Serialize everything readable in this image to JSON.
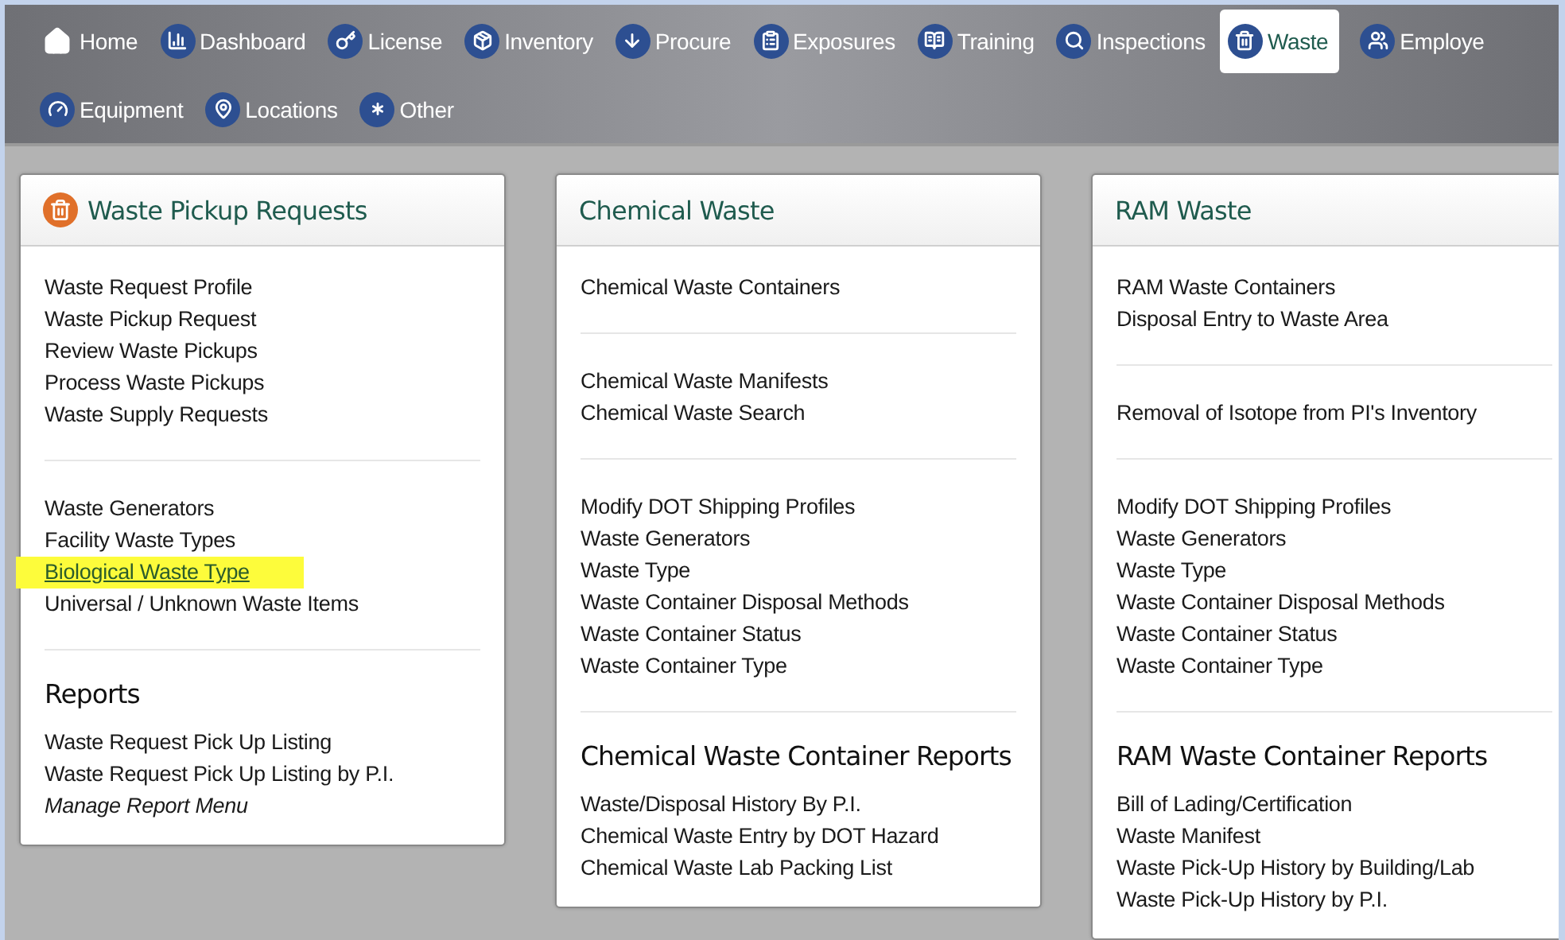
{
  "nav": {
    "rows": [
      [
        {
          "label": "Home",
          "selected": false
        },
        {
          "label": "Dashboard",
          "selected": false
        },
        {
          "label": "License",
          "selected": false
        },
        {
          "label": "Inventory",
          "selected": false
        },
        {
          "label": "Procure",
          "selected": false
        },
        {
          "label": "Exposures",
          "selected": false
        },
        {
          "label": "Training",
          "selected": false
        },
        {
          "label": "Inspections",
          "selected": false
        },
        {
          "label": "Waste",
          "selected": true
        },
        {
          "label": "Employe",
          "selected": false
        }
      ],
      [
        {
          "label": "Equipment",
          "selected": false
        },
        {
          "label": "Locations",
          "selected": false
        },
        {
          "label": "Other",
          "selected": false
        }
      ]
    ]
  },
  "panels": [
    {
      "title": "Waste Pickup Requests",
      "sections": [
        {
          "links": [
            {
              "text": "Waste Request Profile",
              "kind": "link"
            },
            {
              "text": "Waste Pickup Request",
              "kind": "link"
            },
            {
              "text": "Review Waste Pickups",
              "kind": "link"
            },
            {
              "text": "Process Waste Pickups",
              "kind": "link"
            },
            {
              "text": "Waste Supply Requests",
              "kind": "link"
            }
          ]
        },
        {
          "links": [
            {
              "text": "Waste Generators",
              "kind": "link"
            },
            {
              "text": "Facility Waste Types",
              "kind": "link"
            },
            {
              "text": "Biological Waste Type",
              "kind": "highlighted"
            },
            {
              "text": "Universal / Unknown Waste Items",
              "kind": "link"
            }
          ]
        },
        {
          "heading": "Reports",
          "links": [
            {
              "text": "Waste Request Pick Up Listing",
              "kind": "link"
            },
            {
              "text": "Waste Request Pick Up Listing by P.I.",
              "kind": "link"
            },
            {
              "text": "Manage Report Menu",
              "kind": "menu"
            }
          ]
        }
      ]
    },
    {
      "title": "Chemical Waste",
      "sections": [
        {
          "links": [
            {
              "text": "Chemical Waste Containers",
              "kind": "link"
            }
          ]
        },
        {
          "links": [
            {
              "text": "Chemical Waste Manifests",
              "kind": "link"
            },
            {
              "text": "Chemical Waste Search",
              "kind": "link"
            }
          ]
        },
        {
          "links": [
            {
              "text": "Modify DOT Shipping Profiles",
              "kind": "link"
            },
            {
              "text": "Waste Generators",
              "kind": "link"
            },
            {
              "text": "Waste Type",
              "kind": "link"
            },
            {
              "text": "Waste Container Disposal Methods",
              "kind": "link"
            },
            {
              "text": "Waste Container Status",
              "kind": "link"
            },
            {
              "text": "Waste Container Type",
              "kind": "link"
            }
          ]
        },
        {
          "heading": "Chemical Waste Container Reports",
          "links": [
            {
              "text": "Waste/Disposal History By P.I.",
              "kind": "link"
            },
            {
              "text": "Chemical Waste Entry by DOT Hazard",
              "kind": "link"
            },
            {
              "text": "Chemical Waste Lab Packing List",
              "kind": "link"
            }
          ]
        }
      ]
    },
    {
      "title": "RAM Waste",
      "sections": [
        {
          "links": [
            {
              "text": "RAM Waste Containers",
              "kind": "link"
            },
            {
              "text": "Disposal Entry to Waste Area",
              "kind": "link"
            }
          ]
        },
        {
          "links": [
            {
              "text": "Removal of Isotope from PI's Inventory",
              "kind": "link"
            }
          ]
        },
        {
          "links": [
            {
              "text": "Modify DOT Shipping Profiles",
              "kind": "link"
            },
            {
              "text": "Waste Generators",
              "kind": "link"
            },
            {
              "text": "Waste Type",
              "kind": "link"
            },
            {
              "text": "Waste Container Disposal Methods",
              "kind": "link"
            },
            {
              "text": "Waste Container Status",
              "kind": "link"
            },
            {
              "text": "Waste Container Type",
              "kind": "link"
            }
          ]
        },
        {
          "heading": "RAM Waste Container Reports",
          "links": [
            {
              "text": "Bill of Lading/Certification",
              "kind": "link"
            },
            {
              "text": "Waste Manifest",
              "kind": "link"
            },
            {
              "text": "Waste Pick-Up History by Building/Lab",
              "kind": "link"
            },
            {
              "text": "Waste Pick-Up History by P.I.",
              "kind": "link"
            }
          ]
        }
      ]
    }
  ]
}
